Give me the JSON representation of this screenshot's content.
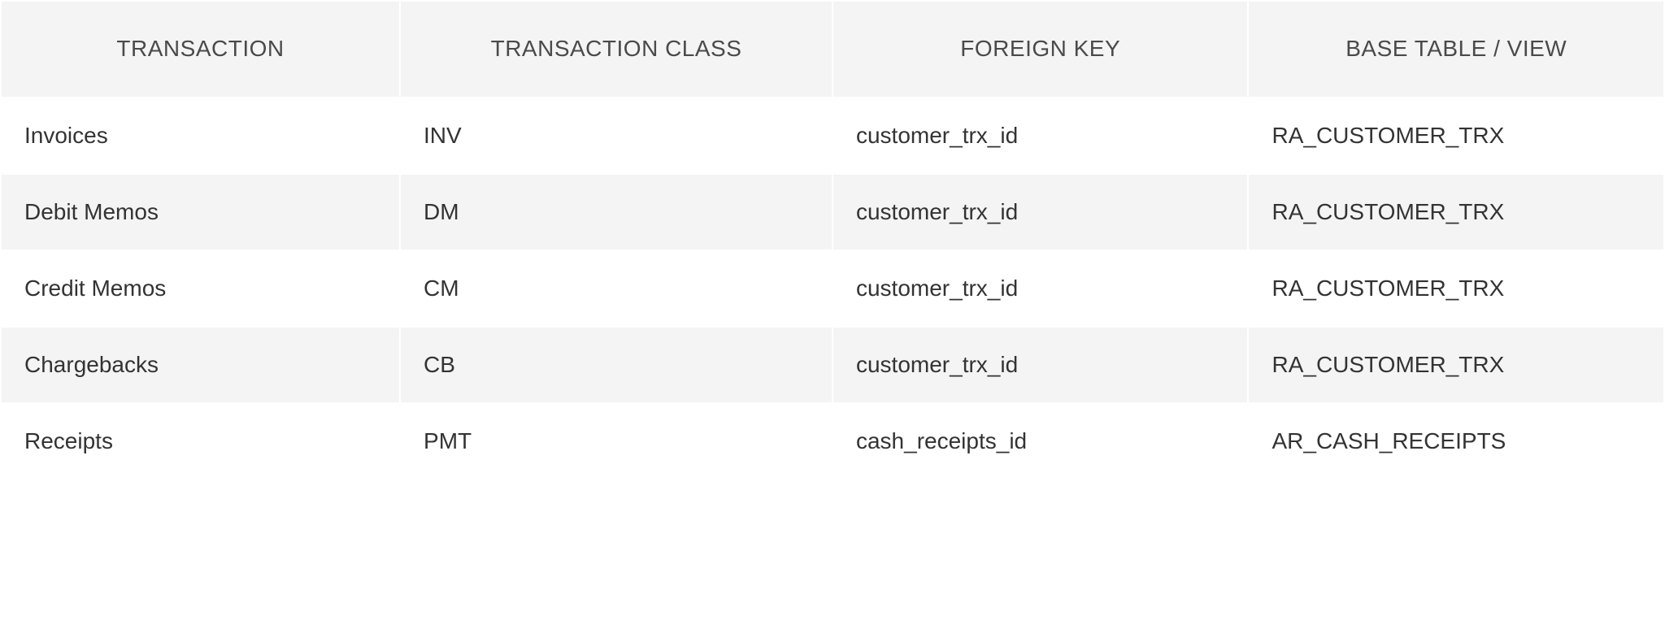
{
  "table": {
    "headers": {
      "transaction": "TRANSACTION",
      "transaction_class": "TRANSACTION CLASS",
      "foreign_key": "FOREIGN KEY",
      "base_table": "BASE TABLE / VIEW"
    },
    "rows": [
      {
        "transaction": "Invoices",
        "transaction_class": "INV",
        "foreign_key": "customer_trx_id",
        "base_table": "RA_CUSTOMER_TRX"
      },
      {
        "transaction": "Debit Memos",
        "transaction_class": "DM",
        "foreign_key": "customer_trx_id",
        "base_table": "RA_CUSTOMER_TRX"
      },
      {
        "transaction": "Credit Memos",
        "transaction_class": "CM",
        "foreign_key": "customer_trx_id",
        "base_table": "RA_CUSTOMER_TRX"
      },
      {
        "transaction": "Chargebacks",
        "transaction_class": "CB",
        "foreign_key": "customer_trx_id",
        "base_table": "RA_CUSTOMER_TRX"
      },
      {
        "transaction": "Receipts",
        "transaction_class": "PMT",
        "foreign_key": "cash_receipts_id",
        "base_table": "AR_CASH_RECEIPTS"
      }
    ]
  }
}
